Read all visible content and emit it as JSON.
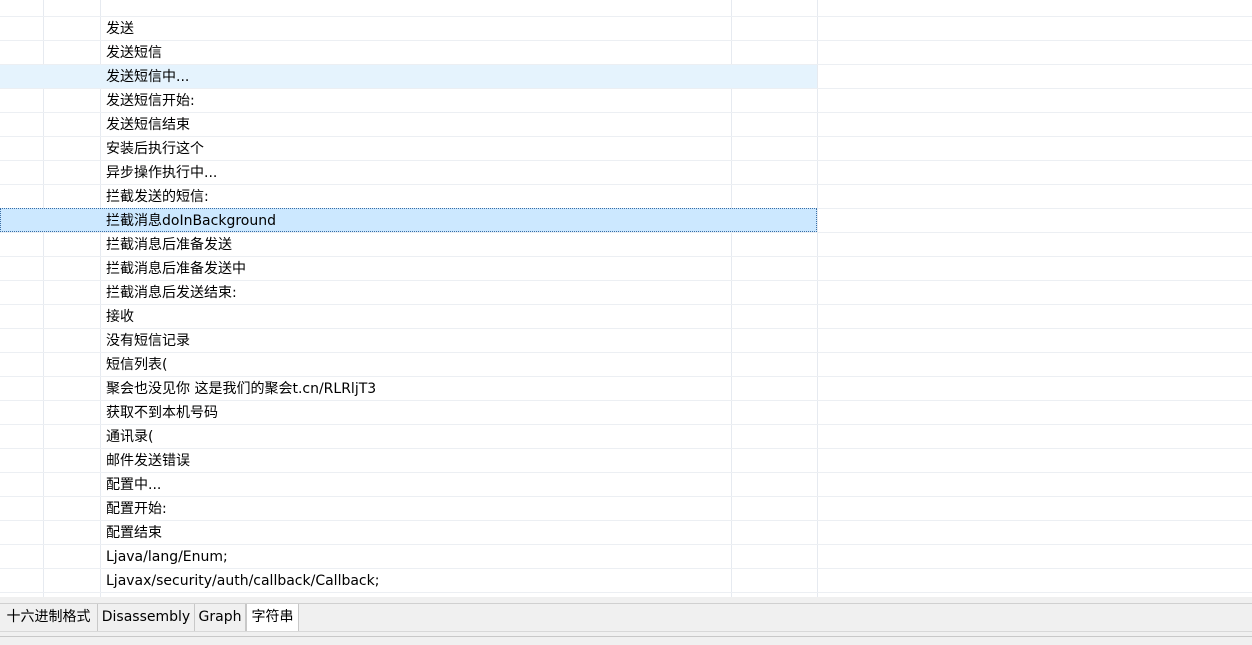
{
  "rows": [
    {
      "text": ""
    },
    {
      "text": "发送"
    },
    {
      "text": "发送短信"
    },
    {
      "text": "发送短信中..."
    },
    {
      "text": "发送短信开始:"
    },
    {
      "text": "发送短信结束"
    },
    {
      "text": "安装后执行这个"
    },
    {
      "text": "异步操作执行中..."
    },
    {
      "text": "拦截发送的短信:"
    },
    {
      "text": "拦截消息doInBackground"
    },
    {
      "text": "拦截消息后准备发送"
    },
    {
      "text": "拦截消息后准备发送中"
    },
    {
      "text": "拦截消息后发送结束:"
    },
    {
      "text": "接收"
    },
    {
      "text": "没有短信记录"
    },
    {
      "text": "短信列表("
    },
    {
      "text": "聚会也没见你 这是我们的聚会t.cn/RLRljT3"
    },
    {
      "text": "获取不到本机号码"
    },
    {
      "text": "通讯录("
    },
    {
      "text": "邮件发送错误"
    },
    {
      "text": "配置中..."
    },
    {
      "text": "配置开始:"
    },
    {
      "text": "配置结束"
    },
    {
      "text": "Ljava/lang/Enum;"
    },
    {
      "text": "Ljavax/security/auth/callback/Callback;"
    },
    {
      "text": ""
    }
  ],
  "hover_row": 3,
  "selected_row": 9,
  "tabs": [
    {
      "label": "十六进制格式"
    },
    {
      "label": "Disassembly"
    },
    {
      "label": "Graph"
    },
    {
      "label": "字符串",
      "active": true
    }
  ]
}
